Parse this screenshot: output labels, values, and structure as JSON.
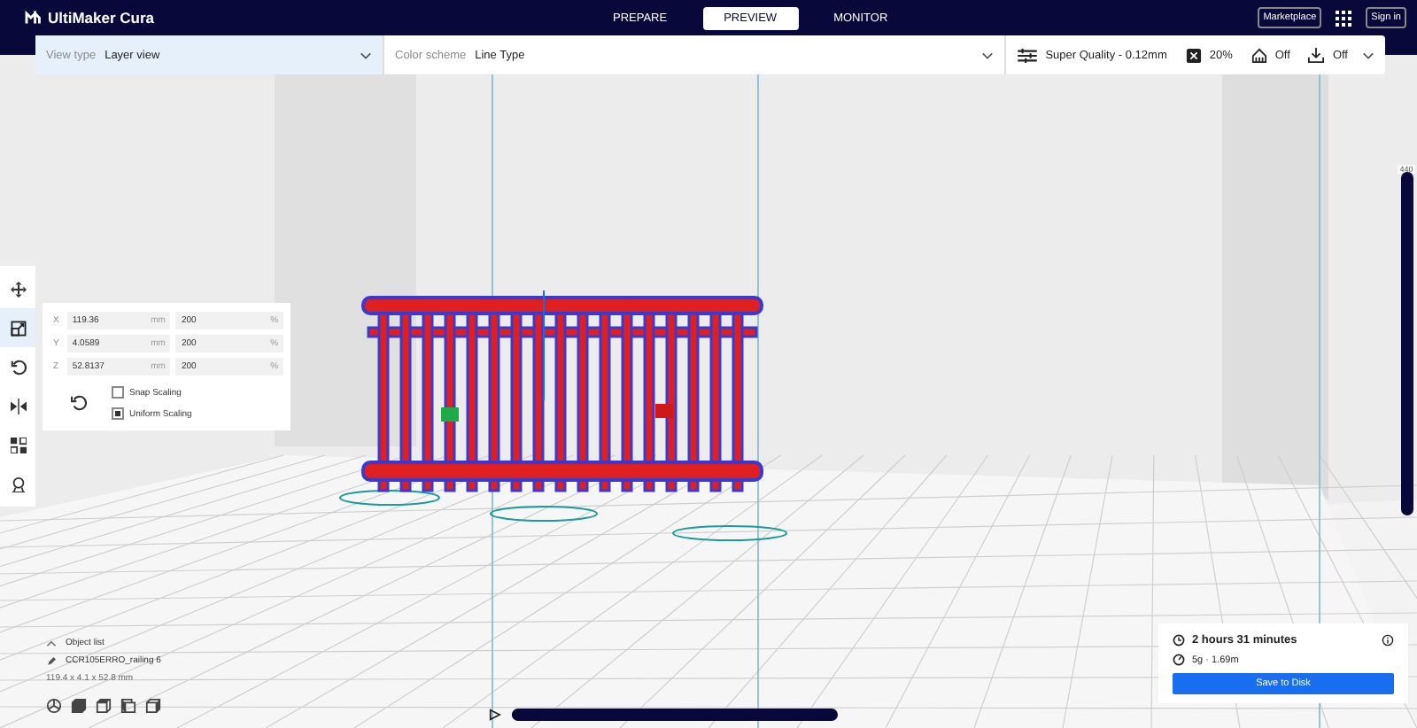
{
  "header": {
    "logo": "UltiMaker Cura",
    "stages": [
      {
        "label": "PREPARE",
        "selected": false
      },
      {
        "label": "PREVIEW",
        "selected": true
      },
      {
        "label": "MONITOR",
        "selected": false
      }
    ],
    "marketplace": "Marketplace",
    "sign_in": "Sign in"
  },
  "view_bar": {
    "view_type": {
      "label": "View type",
      "value": "Layer view"
    },
    "color_scheme": {
      "label": "Color scheme",
      "value": "Line Type"
    },
    "print_settings": {
      "profile": "Super Quality - 0.12mm",
      "infill": "20%",
      "support": "Off",
      "adhesion": "Off"
    }
  },
  "tools": [
    {
      "kind": "move",
      "selected": false
    },
    {
      "kind": "scale",
      "selected": true
    },
    {
      "kind": "rotate",
      "selected": false
    },
    {
      "kind": "mirror",
      "selected": false
    },
    {
      "kind": "per-model",
      "selected": false
    },
    {
      "kind": "support",
      "selected": false
    }
  ],
  "scale_panel": {
    "rows": [
      {
        "axis": "X",
        "mm": "119.36",
        "unit": "mm",
        "percent": "200",
        "percent_unit": "%"
      },
      {
        "axis": "Y",
        "mm": "4.0589",
        "unit": "mm",
        "percent": "200",
        "percent_unit": "%"
      },
      {
        "axis": "Z",
        "mm": "52.8137",
        "unit": "mm",
        "percent": "200",
        "percent_unit": "%"
      }
    ],
    "snap_scaling": {
      "label": "Snap Scaling",
      "checked": false
    },
    "uniform_scaling": {
      "label": "Uniform Scaling",
      "checked": true
    }
  },
  "object_list": {
    "title": "Object list",
    "object_name": "CCR105ERRO_railing 6",
    "dimensions": "119.4 x 4.1 x 52.8 mm"
  },
  "layer_slider": {
    "top_label": "440",
    "level": 1
  },
  "layer_player": {
    "level": 1
  },
  "print_info": {
    "time": "2 hours 31 minutes",
    "material": "5g · 1.69m",
    "save_button": "Save to Disk"
  }
}
